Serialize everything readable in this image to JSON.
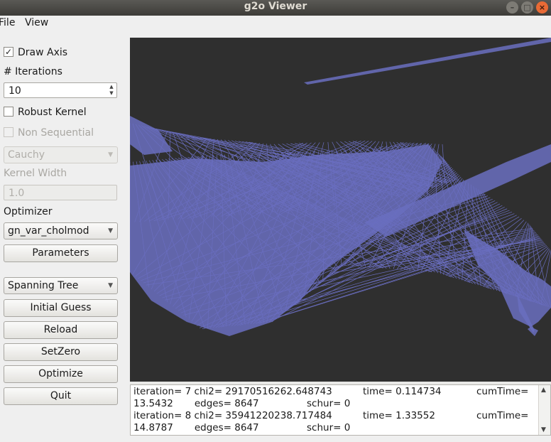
{
  "window": {
    "title": "g2o Viewer",
    "buttons": [
      "–",
      "□",
      "×"
    ]
  },
  "menu": {
    "file": "File",
    "view": "View"
  },
  "panel": {
    "draw_axis": {
      "label": "Draw Axis",
      "checked": true,
      "mark": "✓"
    },
    "iterations_label": "# Iterations",
    "iterations_value": "10",
    "robust_kernel": {
      "label": "Robust Kernel",
      "checked": false
    },
    "non_sequential": {
      "label": "Non Sequential",
      "checked": false,
      "enabled": false
    },
    "kernel_type": "Cauchy",
    "kernel_width_label": "Kernel Width",
    "kernel_width_value": "1.0",
    "optimizer_label": "Optimizer",
    "optimizer_value": "gn_var_cholmod",
    "parameters_button": "Parameters",
    "guess_method": "Spanning Tree",
    "initial_guess_button": "Initial Guess",
    "reload_button": "Reload",
    "setzero_button": "SetZero",
    "optimize_button": "Optimize",
    "quit_button": "Quit"
  },
  "viewport": {
    "background": "#2f2f2f",
    "graph_color": "#6a6ec0"
  },
  "log": [
    {
      "a": "iteration= 7 chi2= 29170516262.648743",
      "b": "time= 0.114734",
      "c": "cumTime="
    },
    {
      "a": "13.5432       edges= 8647",
      "b": "schur= 0",
      "c": ""
    },
    {
      "a": "iteration= 8 chi2= 35941220238.717484",
      "b": "time= 1.33552",
      "c": "cumTime="
    },
    {
      "a": "14.8787       edges= 8647",
      "b": "schur= 0",
      "c": ""
    }
  ]
}
